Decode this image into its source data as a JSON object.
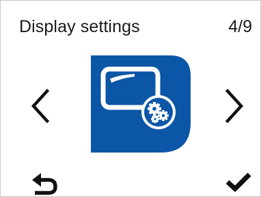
{
  "header": {
    "title": "Display settings",
    "page_counter": "4/9"
  },
  "carousel": {
    "prev_icon": "chevron-left-icon",
    "next_icon": "chevron-right-icon",
    "item_icon": "display-settings-icon"
  },
  "footer": {
    "back_icon": "back-arrow-icon",
    "confirm_icon": "checkmark-icon"
  },
  "colors": {
    "accent": "#0b56a6",
    "text": "#1a1a1a",
    "background": "#ffffff"
  }
}
